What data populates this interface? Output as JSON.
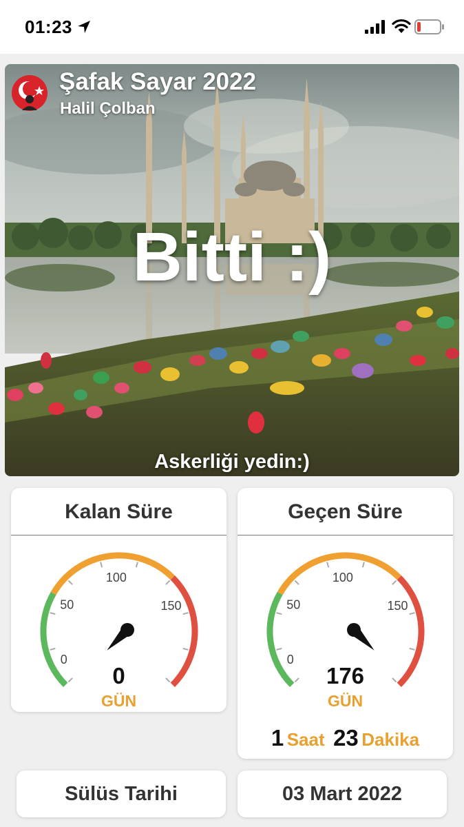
{
  "status_bar": {
    "time": "01:23"
  },
  "header": {
    "title": "Şafak Sayar 2022",
    "subtitle": "Halil Çolban"
  },
  "hero": {
    "status_text": "Bitti :)",
    "caption": "Askerliği yedin:)"
  },
  "remaining_card": {
    "title": "Kalan Süre",
    "value": "0",
    "unit": "GÜN",
    "gauge_level": 0,
    "gauge_max": 176
  },
  "elapsed_card": {
    "title": "Geçen Süre",
    "value": "176",
    "unit": "GÜN",
    "gauge_level": 176,
    "gauge_max": 176,
    "hours": "1",
    "hours_label": "Saat",
    "minutes": "23",
    "minutes_label": "Dakika"
  },
  "gauge_ticks": [
    "0",
    "50",
    "100",
    "150"
  ],
  "footer": {
    "date_label": "Sülüs Tarihi",
    "date_value": "03 Mart 2022"
  },
  "colors": {
    "gauge_green": "#5cb85c",
    "gauge_orange": "#f0a030",
    "gauge_red": "#e05040",
    "unit_orange": "#e8a030"
  }
}
